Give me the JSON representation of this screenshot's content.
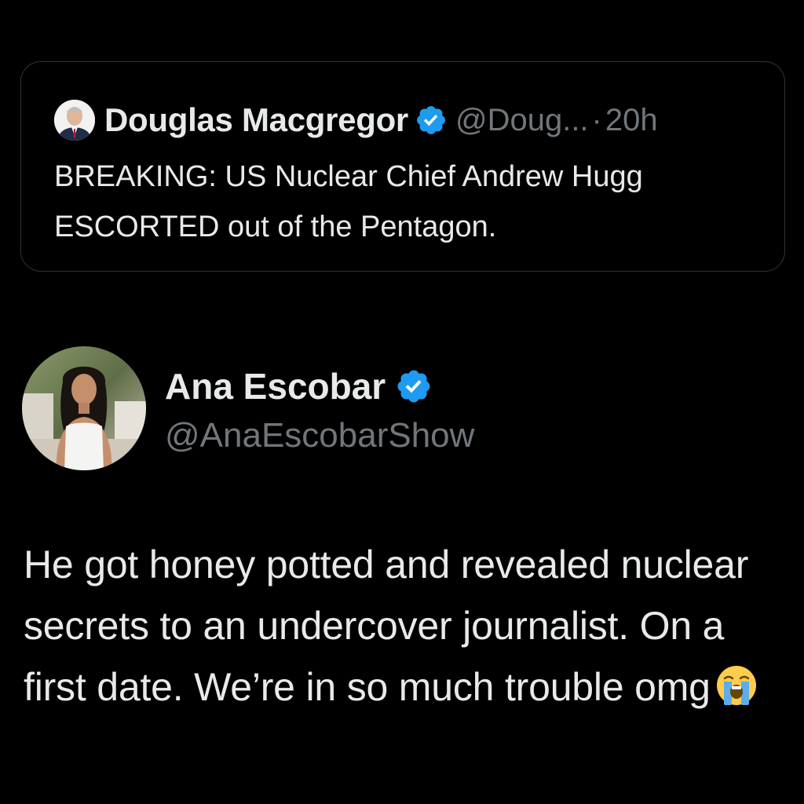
{
  "quoted_tweet": {
    "author_name": "Douglas Macgregor",
    "handle": "@Doug...",
    "separator": "·",
    "timestamp": "20h",
    "text": "BREAKING: US Nuclear Chief Andrew Hugg ESCORTED out of the Pentagon.",
    "avatar_icon": "person-in-suit-avatar",
    "verified_icon": "verified-badge-icon"
  },
  "tweet": {
    "author_name": "Ana Escobar",
    "handle": "@AnaEscobarShow",
    "text": "He got honey potted and revealed nuclear secrets to an undercover journalist. On a first date. We’re in so much trouble omg",
    "emoji_icon": "loudly-crying-face-icon",
    "avatar_icon": "woman-portrait-avatar",
    "verified_icon": "verified-badge-icon"
  },
  "colors": {
    "background": "#000000",
    "primary_text": "#e7e9ea",
    "secondary_text": "#71767b",
    "verified_blue": "#1d9bf0",
    "card_border": "#2f3336"
  }
}
